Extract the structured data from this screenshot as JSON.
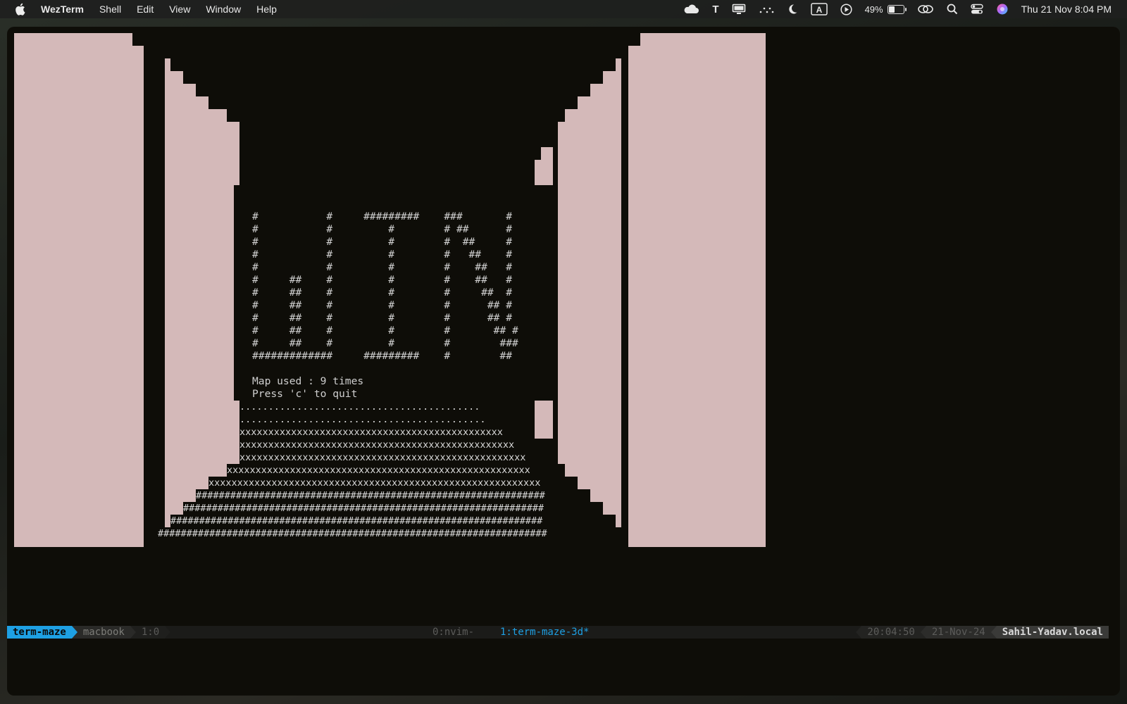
{
  "menubar": {
    "app_name": "WezTerm",
    "menus": [
      "Shell",
      "Edit",
      "View",
      "Window",
      "Help"
    ],
    "status_icons": [
      "cloud-icon",
      "text-t-icon",
      "display-icon",
      "dots-icon",
      "moon-icon",
      "keyboard-a-icon",
      "play-icon"
    ],
    "battery_percent": "49%",
    "battery_level": 0.49,
    "clock": "Thu 21 Nov  8:04 PM"
  },
  "terminal": {
    "wall_color": "#d4b9b9",
    "background_color": "#0e0d08",
    "win_banner": [
      "#           #     #########    ###       #",
      "#           #         #        # ##      #",
      "#           #         #        #  ##     #",
      "#           #         #        #   ##    #",
      "#           #         #        #    ##   #",
      "#     ##    #         #        #    ##   #",
      "#     ##    #         #        #     ##  #",
      "#     ##    #         #        #      ## #",
      "#     ##    #         #        #      ## #",
      "#     ##    #         #        #       ## #",
      "#     ##    #         #        #        ###",
      "#############     #########    #        ##"
    ],
    "message_line1": "Map used : 9 times",
    "message_line2": "Press 'c' to quit",
    "floor_rows": [
      "..........................................",
      "...........................................",
      "xxxxxxxxxxxxxxxxxxxxxxxxxxxxxxxxxxxxxxxxxxxxxx",
      "xxxxxxxxxxxxxxxxxxxxxxxxxxxxxxxxxxxxxxxxxxxxxxxx",
      "xxxxxxxxxxxxxxxxxxxxxxxxxxxxxxxxxxxxxxxxxxxxxxxxxx",
      "xxxxxxxxxxxxxxxxxxxxxxxxxxxxxxxxxxxxxxxxxxxxxxxxxxxxx",
      "xxxxxxxxxxxxxxxxxxxxxxxxxxxxxxxxxxxxxxxxxxxxxxxxxxxxxxxxxx",
      "#############################################################",
      "###############################################################",
      "#################################################################",
      "####################################################################"
    ]
  },
  "tmux": {
    "session": "term-maze",
    "host": "macbook",
    "pane": "1:0",
    "window_inactive": "0:nvim-",
    "window_active": "1:term-maze-3d*",
    "active_color": "#1ea0e4",
    "time": "20:04:50",
    "date": "21-Nov-24",
    "hostname": "Sahil-Yadav.local"
  }
}
